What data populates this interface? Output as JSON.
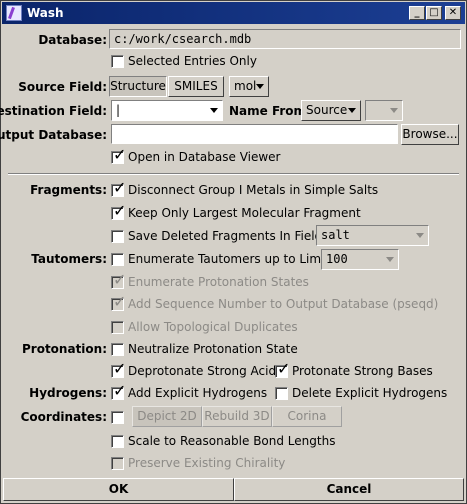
{
  "window": {
    "title": "Wash"
  },
  "database": {
    "label": "Database:",
    "value": "c:/work/csearch.mdb"
  },
  "selected_entries_only": {
    "label": "Selected Entries Only",
    "checked": false
  },
  "source_field": {
    "label": "Source Field:",
    "buttons": [
      "Structure",
      "SMILES"
    ],
    "selected": "Structure",
    "format": "mol"
  },
  "destination_field": {
    "label": "Destination Field:",
    "value": "|"
  },
  "name_from": {
    "label": "Name From:",
    "value": "Source",
    "second": ""
  },
  "output_database": {
    "label": "Output Database:",
    "value": "",
    "browse_label": "Browse..."
  },
  "open_in_viewer": {
    "label": "Open in Database Viewer",
    "checked": true
  },
  "fragments": {
    "label": "Fragments:",
    "disconnect": "Disconnect Group I Metals in Simple Salts",
    "keep_largest": "Keep Only Largest Molecular Fragment",
    "save_deleted": "Save Deleted Fragments In Field:",
    "save_field": "salt"
  },
  "tautomers": {
    "label": "Tautomers:",
    "enumerate": "Enumerate Tautomers up to Limit:",
    "limit": "100",
    "protonation_states": "Enumerate Protonation States",
    "sequence_number": "Add Sequence Number to Output Database (pseqd)",
    "topological": "Allow Topological Duplicates"
  },
  "protonation": {
    "label": "Protonation:",
    "neutralize": "Neutralize Protonation State",
    "deprotonate": "Deprotonate Strong Acids",
    "protonate": "Protonate Strong Bases"
  },
  "hydrogens": {
    "label": "Hydrogens:",
    "add": "Add Explicit Hydrogens",
    "delete": "Delete Explicit Hydrogens"
  },
  "coordinates": {
    "label": "Coordinates:",
    "buttons": [
      "Depict 2D",
      "Rebuild 3D",
      "Corina"
    ],
    "scale": "Scale to Reasonable Bond Lengths",
    "chirality": "Preserve Existing Chirality"
  },
  "footer": {
    "ok": "OK",
    "cancel": "Cancel"
  }
}
